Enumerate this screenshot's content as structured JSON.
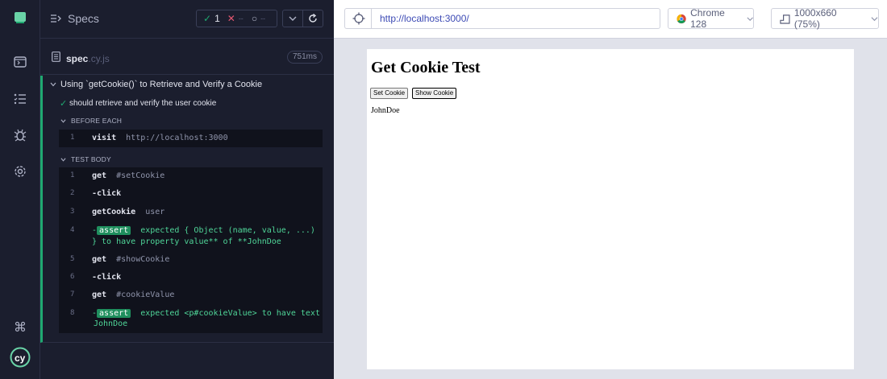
{
  "reporter": {
    "header_title": "Specs",
    "stats": {
      "passed": "1",
      "failed": "--",
      "pending": "--"
    },
    "spec_file": {
      "name": "spec",
      "ext": ".cy.js",
      "duration": "751ms"
    },
    "suite_title": "Using `getCookie()` to Retrieve and Verify a Cookie",
    "test_title": "should retrieve and verify the user cookie",
    "hooks": [
      {
        "label": "BEFORE EACH",
        "commands": [
          {
            "num": "1",
            "name": "visit",
            "arg": "http://localhost:3000"
          }
        ]
      },
      {
        "label": "TEST BODY",
        "commands": [
          {
            "num": "1",
            "name": "get",
            "arg": "#setCookie"
          },
          {
            "num": "2",
            "name": "-click",
            "arg": ""
          },
          {
            "num": "3",
            "name": "getCookie",
            "arg": "user"
          },
          {
            "num": "4",
            "name": "assert",
            "line1": "expected  { Object (name, value, ...)",
            "line2": "}  to have property  value** of **JohnDoe"
          },
          {
            "num": "5",
            "name": "get",
            "arg": "#showCookie"
          },
          {
            "num": "6",
            "name": "-click",
            "arg": ""
          },
          {
            "num": "7",
            "name": "get",
            "arg": "#cookieValue"
          },
          {
            "num": "8",
            "name": "assert",
            "line1": "expected  <p#cookieValue>  to have text",
            "line2": "JohnDoe"
          }
        ]
      }
    ]
  },
  "browser": {
    "url": "http://localhost:3000/",
    "browser_name": "Chrome 128",
    "viewport": "1000x660 (75%)"
  },
  "app": {
    "heading": "Get Cookie Test",
    "set_button": "Set Cookie",
    "show_button": "Show Cookie",
    "cookie_value": "JohnDoe"
  },
  "colors": {
    "pass_green": "#1fa971",
    "assert_green": "#1f8f5e",
    "url_blue": "#3d4bb5"
  }
}
